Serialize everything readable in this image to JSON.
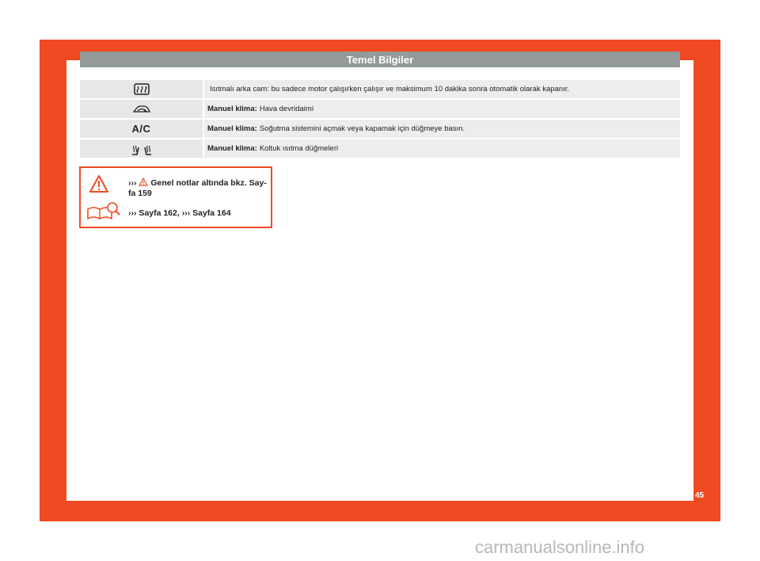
{
  "header": {
    "title": "Temel Bilgiler"
  },
  "table": {
    "rows": [
      {
        "icon": "rear-defrost-icon",
        "bold": "",
        "text": "Isıtmalı arka cam: bu sadece motor çalışırken çalışır ve maksimum 10 dakika sonra otomatik olarak kapanır."
      },
      {
        "icon": "air-recirculation-icon",
        "bold": "Manuel klima:",
        "text": "Hava devridaimi"
      },
      {
        "icon": "ac-icon",
        "icon_text": "A/C",
        "bold": "Manuel klima:",
        "text": "Soğutma sistemini açmak veya kapamak için düğmeye basın."
      },
      {
        "icon": "seat-heating-icon",
        "bold": "Manuel klima:",
        "text": "Koltuk ısıtma düğmeleri"
      }
    ]
  },
  "warning": {
    "prefix": "›››",
    "line1": "Genel notlar altında bkz. Say-fa 159",
    "line2": "››› Sayfa 162, ››› Sayfa 164"
  },
  "footer": {
    "page_number": "45"
  },
  "watermark": "carmanualsonline.info",
  "colors": {
    "accent": "#f04a23",
    "header_gray": "#939a99"
  }
}
